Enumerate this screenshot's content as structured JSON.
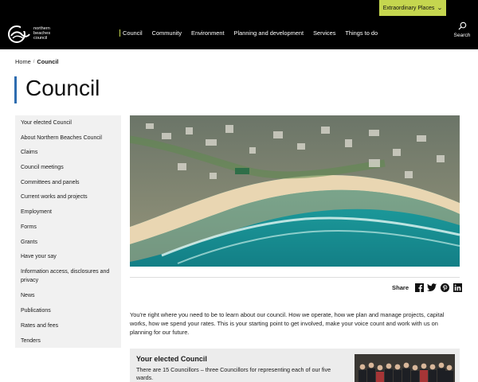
{
  "utility": {
    "extraordinary_label": "Extraordinary Places"
  },
  "header": {
    "logo_line1": "northern",
    "logo_line2": "beaches",
    "logo_line3": "council",
    "nav": [
      "Council",
      "Community",
      "Environment",
      "Planning and development",
      "Services",
      "Things to do"
    ],
    "search_label": "Search"
  },
  "breadcrumb": {
    "home": "Home",
    "current": "Council"
  },
  "page": {
    "title": "Council"
  },
  "sidebar": {
    "items": [
      "Your elected Council",
      "About Northern Beaches Council",
      "Claims",
      "Council meetings",
      "Committees and panels",
      "Current works and projects",
      "Employment",
      "Forms",
      "Grants",
      "Have your say",
      "Information access, disclosures and privacy",
      "News",
      "Publications",
      "Rates and fees",
      "Tenders"
    ]
  },
  "share": {
    "label": "Share",
    "icons": [
      "facebook-icon",
      "twitter-icon",
      "pinterest-icon",
      "linkedin-icon"
    ]
  },
  "intro": {
    "text": "You're right where you need to be to learn about our council. How we operate, how we plan and manage projects, capital works, how we spend your rates. This is your starting point to get involved, make your voice count and work with us on planning for our future."
  },
  "card": {
    "title": "Your elected Council",
    "text": "There are 15 Councillors – three Councillors for representing each of our five wards."
  },
  "colors": {
    "accent_green": "#c5d64f",
    "title_bar_blue": "#2e6db0",
    "header_bg": "#000000"
  }
}
